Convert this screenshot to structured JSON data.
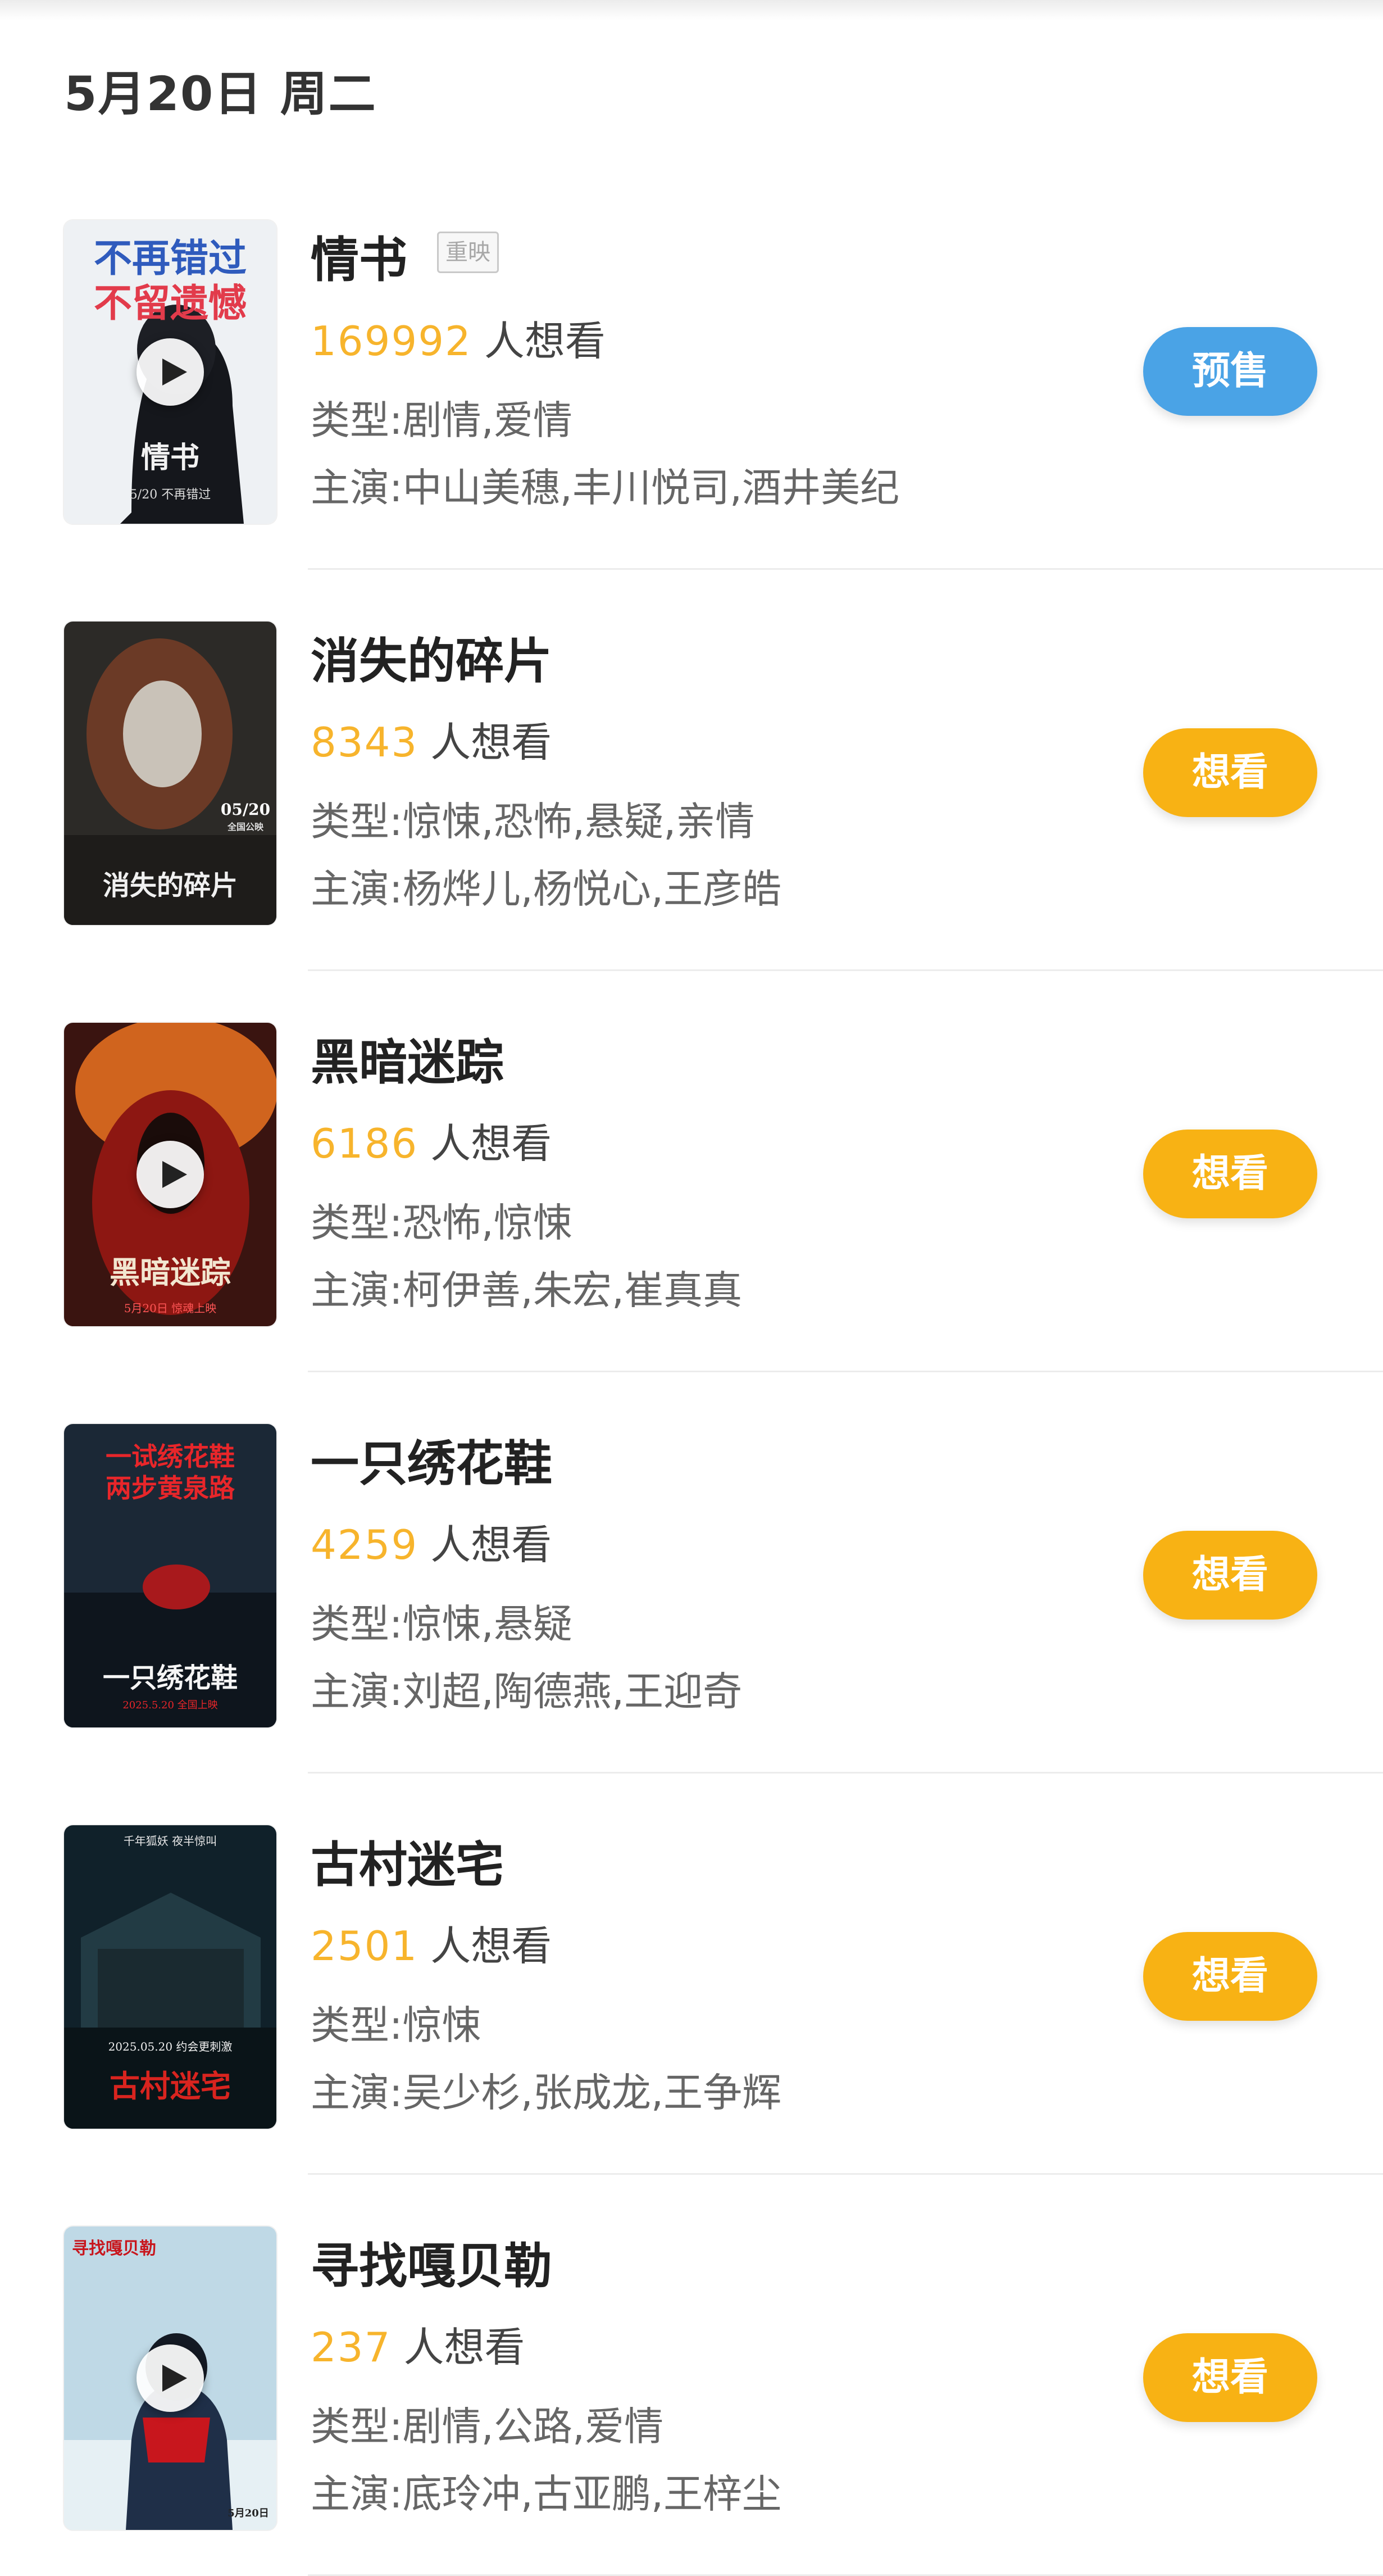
{
  "date_header": "5月20日 周二",
  "wish_suffix": "人想看",
  "genre_prefix": "类型:",
  "cast_prefix": "主演:",
  "colors": {
    "wish_count": "#f7b42c",
    "presale_button": "#4aa3e6",
    "want_button": "#f8b214"
  },
  "movies": [
    {
      "title": "情书",
      "badge": "重映",
      "wish_count": "169992",
      "genres": "剧情,爱情",
      "cast": "中山美穗,丰川悦司,酒井美纪",
      "button": "预售",
      "poster": {
        "line1": "不再错过",
        "line2": "不留遗憾",
        "caption": "情书",
        "date": "5/20 不再错过",
        "has_play": true
      }
    },
    {
      "title": "消失的碎片",
      "wish_count": "8343",
      "genres": "惊悚,恐怖,悬疑,亲情",
      "cast": "杨烨儿,杨悦心,王彦皓",
      "button": "想看",
      "poster": {
        "date": "05/20",
        "sub": "全国公映",
        "caption": "消失的碎片",
        "has_play": false
      }
    },
    {
      "title": "黑暗迷踪",
      "wish_count": "6186",
      "genres": "恐怖,惊悚",
      "cast": "柯伊善,朱宏,崔真真",
      "button": "想看",
      "poster": {
        "caption": "黑暗迷踪",
        "date": "5月20日 惊魂上映",
        "has_play": true
      }
    },
    {
      "title": "一只绣花鞋",
      "wish_count": "4259",
      "genres": "惊悚,悬疑",
      "cast": "刘超,陶德燕,王迎奇",
      "button": "想看",
      "poster": {
        "line1": "一试绣花鞋",
        "line2": "两步黄泉路",
        "caption": "一只绣花鞋",
        "date": "2025.5.20 全国上映",
        "has_play": false
      }
    },
    {
      "title": "古村迷宅",
      "wish_count": "2501",
      "genres": "惊悚",
      "cast": "吴少杉,张成龙,王争辉",
      "button": "想看",
      "poster": {
        "line1": "千年狐妖 夜半惊叫",
        "date": "2025.05.20 约会更刺激",
        "caption": "古村迷宅",
        "has_play": false
      }
    },
    {
      "title": "寻找嘎贝勒",
      "wish_count": "237",
      "genres": "剧情,公路,爱情",
      "cast": "底玲冲,古亚鹏,王梓尘",
      "button": "想看",
      "poster": {
        "line1": "寻找嘎贝勒",
        "date": "5月20日",
        "has_play": true
      }
    }
  ]
}
